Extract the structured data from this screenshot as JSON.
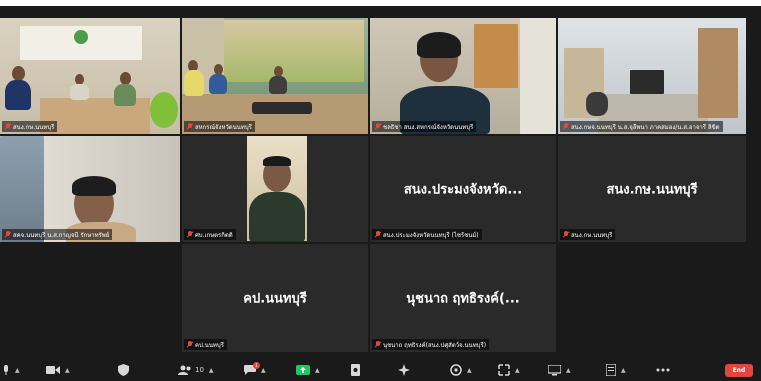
{
  "participants": [
    {
      "name": "สนง.กษ.นนทบุรี",
      "muted": true,
      "active": true
    },
    {
      "name": "สหกรณ์จังหวัดนนทบุรี",
      "muted": true,
      "active": false
    },
    {
      "name": "ชลธิชา สนง.สหกรณ์จังหวัดนนทบุรี",
      "muted": true,
      "active": false
    },
    {
      "name": "สนง.กษจ.นนทบุรี น.ส.จุลีพนา ภาคสมอง/น.ส.อาจารี ลิขิต",
      "muted": true,
      "active": false
    },
    {
      "name": "สคจ.นนทบุรี น.ส.กาญจนี รักษาทรัพย์",
      "muted": true,
      "active": false
    },
    {
      "name": "ศบ.เกษตรกิตติ",
      "muted": true,
      "active": false
    },
    {
      "name": "สนง.ประมงจังหวัด...",
      "tag": "สนง.ประมงจังหวัดนนทบุรี (ไซร้ชนม์)",
      "muted": true,
      "active": false
    },
    {
      "name": "สนง.กษ.นนทบุรี",
      "tag": "สนง.กษ.นนทบุรี",
      "muted": true,
      "active": false
    },
    {
      "name": "คป.นนทบุรี",
      "tag": "คป.นนทบุรี",
      "muted": true,
      "active": false
    },
    {
      "name": "นุชนาถ ฤทธิรงค์(...",
      "tag": "นุชนาถ ฤทธิรงค์(สนง.ปศุสัตว์จ.นนทบุรี)",
      "muted": true,
      "active": false
    }
  ],
  "toolbar": {
    "participants_count": "10",
    "chat_badge": "1",
    "end_label": "End"
  },
  "colors": {
    "background": "#1a1a1a",
    "tile": "#2a2a2a",
    "active_outline": "#c8d35a",
    "muted_icon": "#e0483e",
    "share_button": "#23c55e",
    "end_button": "#e0483e"
  },
  "icons": [
    "mic-icon",
    "video-icon",
    "security-icon",
    "participants-icon",
    "chat-icon",
    "share-screen-icon",
    "record-icon",
    "reactions-icon",
    "apps-icon",
    "whiteboard-icon",
    "notes-icon",
    "more-icon"
  ]
}
